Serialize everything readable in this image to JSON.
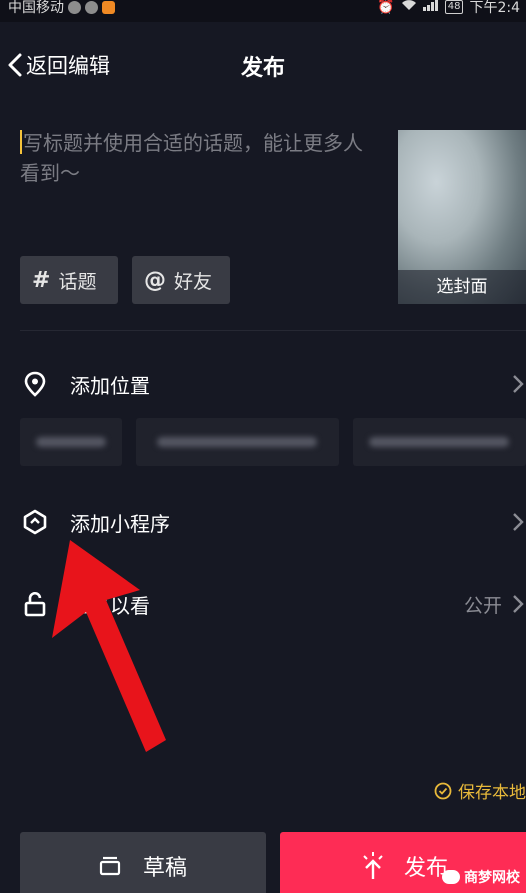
{
  "status_bar": {
    "carrier": "中国移动",
    "battery": "48",
    "time": "下午2:4"
  },
  "header": {
    "back_label": "返回编辑",
    "title": "发布"
  },
  "caption": {
    "placeholder": "写标题并使用合适的话题，能让更多人看到～"
  },
  "cover": {
    "label": "选封面"
  },
  "tags": {
    "topic_symbol": "#",
    "topic_label": "话题",
    "friend_symbol": "@",
    "friend_label": "好友"
  },
  "rows": {
    "location_label": "添加位置",
    "mini_program_label": "添加小程序",
    "visibility_label": "谁可以看",
    "visibility_value": "公开"
  },
  "footer": {
    "save_local_label": "保存本地",
    "draft_label": "草稿",
    "publish_label": "发布"
  },
  "watermark": "商梦网校",
  "colors": {
    "background": "#161823",
    "accent": "#fe2c55",
    "save_local": "#e8b93a",
    "annotation_arrow": "#e8141b"
  }
}
